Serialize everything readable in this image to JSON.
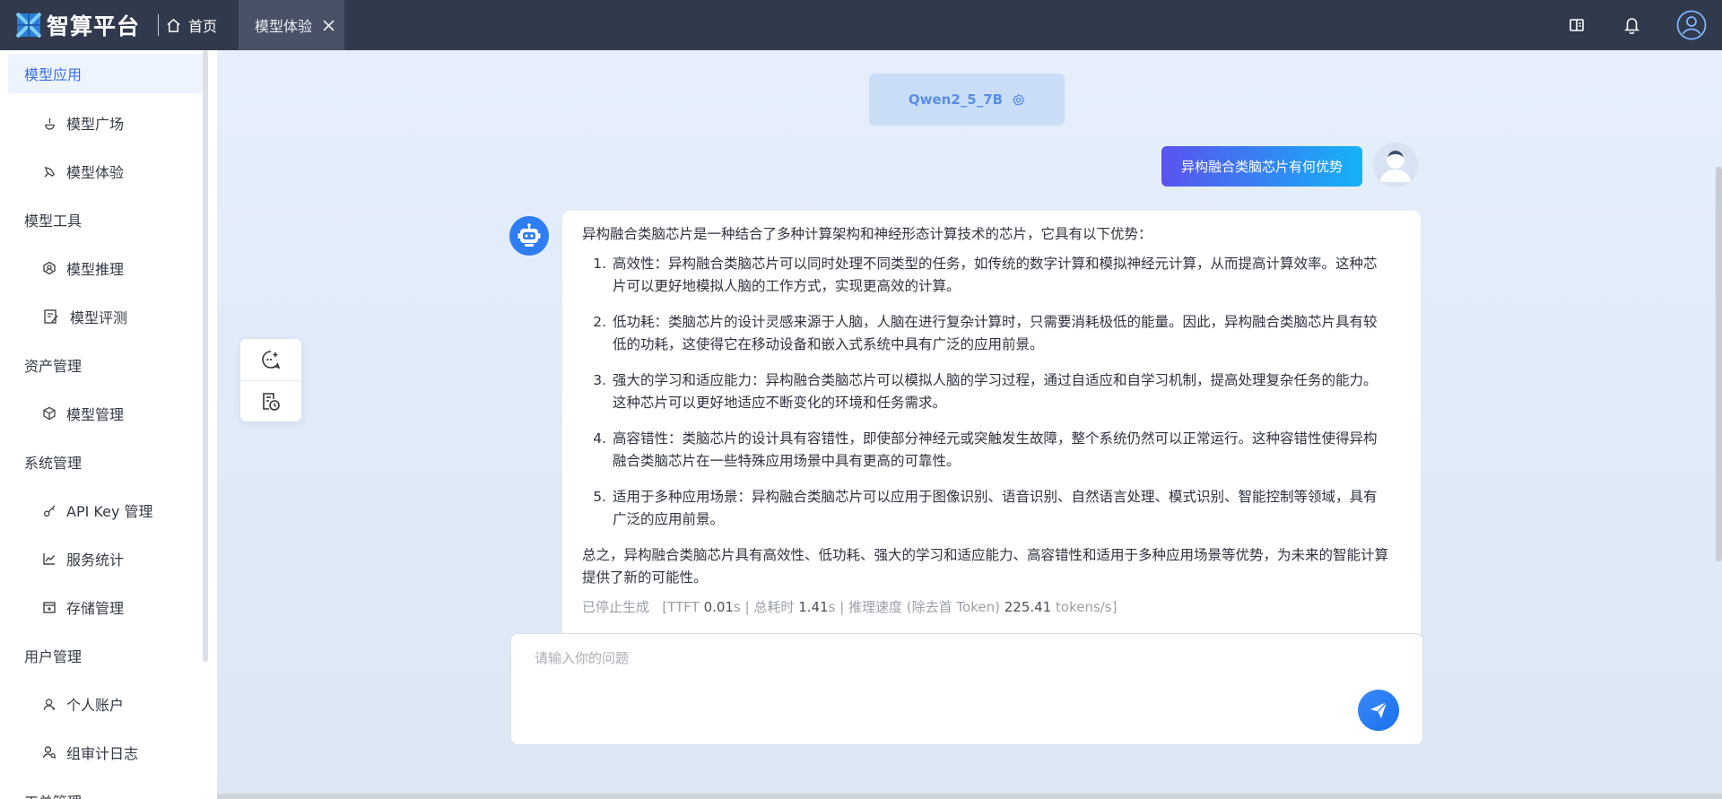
{
  "header": {
    "brand": "智算平台",
    "home_label": "首页",
    "active_tab": "模型体验"
  },
  "sidebar": {
    "groups": [
      {
        "label": "模型应用",
        "items": [
          "模型广场",
          "模型体验"
        ]
      },
      {
        "label": "模型工具",
        "items": [
          "模型推理",
          "模型评测"
        ]
      },
      {
        "label": "资产管理",
        "items": [
          "模型管理"
        ]
      },
      {
        "label": "系统管理",
        "items": [
          "API Key 管理",
          "服务统计",
          "存储管理"
        ]
      },
      {
        "label": "用户管理",
        "items": [
          "个人账户",
          "组审计日志"
        ]
      },
      {
        "label": "工单管理",
        "items": []
      }
    ]
  },
  "chat": {
    "model_name": "Qwen2_5_7B",
    "user_message": "异构融合类脑芯片有何优势",
    "answer": {
      "intro": "异构融合类脑芯片是一种结合了多种计算架构和神经形态计算技术的芯片，它具有以下优势：",
      "points": [
        "高效性：异构融合类脑芯片可以同时处理不同类型的任务，如传统的数字计算和模拟神经元计算，从而提高计算效率。这种芯片可以更好地模拟人脑的工作方式，实现更高效的计算。",
        "低功耗：类脑芯片的设计灵感来源于人脑，人脑在进行复杂计算时，只需要消耗极低的能量。因此，异构融合类脑芯片具有较低的功耗，这使得它在移动设备和嵌入式系统中具有广泛的应用前景。",
        "强大的学习和适应能力：异构融合类脑芯片可以模拟人脑的学习过程，通过自适应和自学习机制，提高处理复杂任务的能力。这种芯片可以更好地适应不断变化的环境和任务需求。",
        "高容错性：类脑芯片的设计具有容错性，即使部分神经元或突触发生故障，整个系统仍然可以正常运行。这种容错性使得异构融合类脑芯片在一些特殊应用场景中具有更高的可靠性。",
        "适用于多种应用场景：异构融合类脑芯片可以应用于图像识别、语音识别、自然语言处理、模式识别、智能控制等领域，具有广泛的应用前景。"
      ],
      "summary": "总之，异构融合类脑芯片具有高效性、低功耗、强大的学习和适应能力、高容错性和适用于多种应用场景等优势，为未来的智能计算提供了新的可能性。"
    },
    "meta": {
      "status": "已停止生成",
      "ttft_label": "[TTFT",
      "ttft_value": "0.01",
      "ttft_unit": "s",
      "total_label": "| 总耗时",
      "total_value": "1.41",
      "total_unit": "s",
      "speed_label": "| 推理速度 (除去首 Token)",
      "speed_value": "225.41",
      "speed_unit": "tokens/s]"
    },
    "input_placeholder": "请输入你的问题"
  },
  "colors": {
    "topbar": "#313a4c",
    "accent": "#3a6fea",
    "send": "#1a6ff0"
  }
}
